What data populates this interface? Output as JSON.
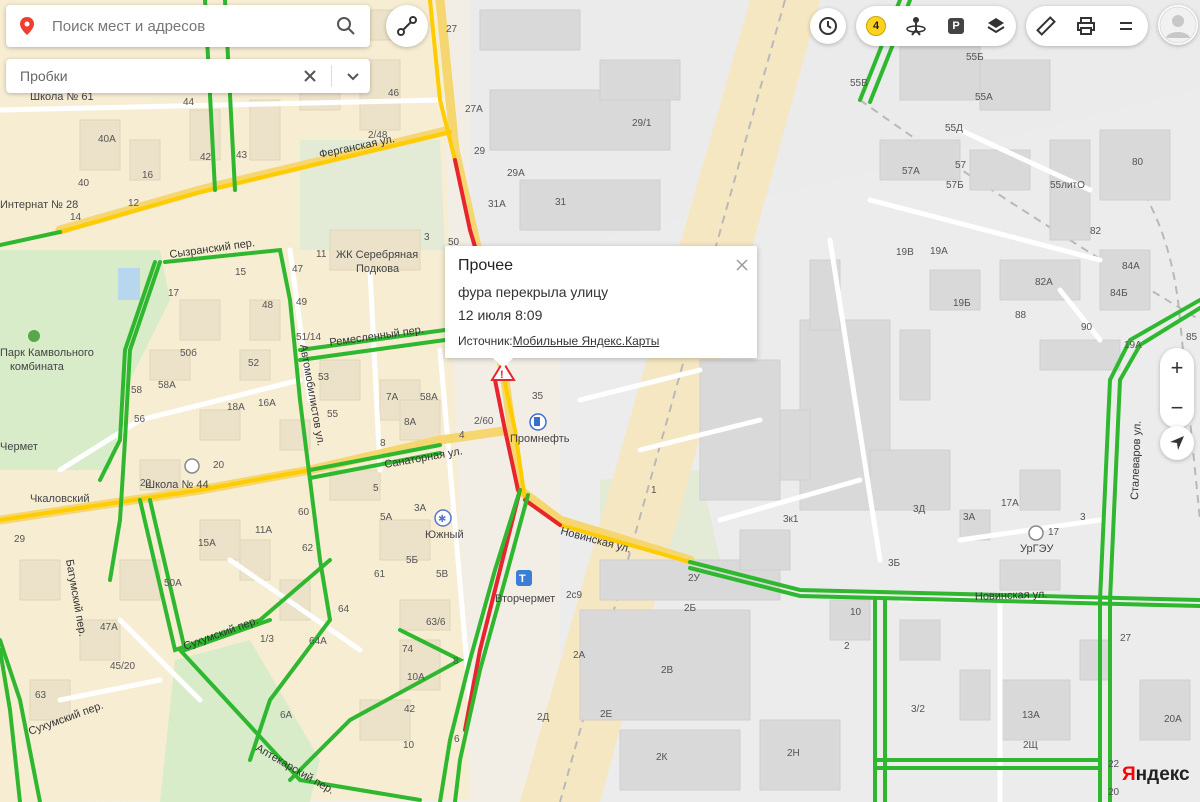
{
  "search": {
    "placeholder": "Поиск мест и адресов"
  },
  "traffic_layer": {
    "label": "Пробки"
  },
  "jams_level": "4",
  "parking_label": "P",
  "popup": {
    "title": "Прочее",
    "description": "фура перекрыла улицу",
    "date": "12 июля 8:09",
    "source_prefix": "Источник:",
    "source_link": "Мобильные Яндекс.Карты"
  },
  "zoom": {
    "in": "+",
    "out": "−"
  },
  "logo": {
    "first": "Я",
    "rest": "ндекс"
  },
  "streets": {
    "mostovaya": "Ремесленный пер.",
    "sanatornaya": "Санаторная ул.",
    "novinskaya1": "Новинская ул.",
    "novinskaya2": "Новинская ул.",
    "sukhumsky1": "Сухумский пер.",
    "sukhumsky2": "Сухумский пер.",
    "batumsky": "Батумский пер.",
    "syzransky": "Сызранский пер.",
    "ferganskaya": "Ферганская ул.",
    "avtomobilnaya": "Автомобилистов ул.",
    "aptekarsky": "Аптекарский пер.",
    "stalevarov": "Сталеваров ул."
  },
  "pois": {
    "school61": "Школа № 61",
    "internat28": "Интернат № 28",
    "park": "Парк Камвольного",
    "park2": "комбината",
    "chermet": "Чермет",
    "chkalovsky": "Чкаловский",
    "school44": "Школа № 44",
    "yuzhny": "Южный",
    "vtorchermet": "Вторчермет",
    "jk": "ЖК Серебряная",
    "jk2": "Подкова",
    "promneft": "Промнефть",
    "urgeu": "УрГЭУ"
  },
  "house_numbers": {
    "h27": "27",
    "h27a": "27А",
    "h29": "29",
    "h29a": "29А",
    "h29_1": "29/1",
    "h31": "31",
    "h31a": "31А",
    "h2_48": "2/48",
    "h46": "46",
    "h42": "42",
    "h43": "43",
    "h44": "44",
    "h40a": "40А",
    "h40": "40",
    "h16": "16",
    "h12": "12",
    "h14": "14",
    "h3": "3",
    "h50": "50",
    "h11": "11",
    "h15": "15",
    "h47": "47",
    "h48": "48",
    "h49": "49",
    "h17": "17",
    "h51_14": "51/14",
    "h506": "50б",
    "h52": "52",
    "h58": "58",
    "h58a": "58А",
    "h56": "56",
    "h18a": "18А",
    "h16a": "16А",
    "h53": "53",
    "h55": "55",
    "h7a": "7А",
    "h58a2": "58А",
    "h8a": "8А",
    "h4": "4",
    "h2_60": "2/60",
    "h35": "35",
    "h8": "8",
    "h20": "20",
    "h22": "22",
    "h5": "5",
    "h5a": "5А",
    "h3a": "3А",
    "h1": "1",
    "h60": "60",
    "h62": "62",
    "h61": "61",
    "h5b": "5Б",
    "h5v": "5В",
    "h64": "64",
    "h63_6": "63/6",
    "h74": "74",
    "h10a": "10А",
    "h42b": "42",
    "h10": "10",
    "h6a": "6А",
    "h1_3": "1/3",
    "h64a": "64А",
    "h29l": "29",
    "h50a": "50А",
    "h45_20": "45/20",
    "h63": "63",
    "h47a": "47А",
    "h11a": "11А",
    "h15a": "15А",
    "h55b": "55Б",
    "h55v": "55В",
    "h55a": "55А",
    "h55d": "55Д",
    "h57": "57",
    "h57a": "57А",
    "h57b": "57Б",
    "h55lito": "55литО",
    "h80": "80",
    "h82": "82",
    "h84a": "84А",
    "h84b": "84Б",
    "h82a": "82А",
    "h88": "88",
    "h90": "90",
    "h19v": "19В",
    "h19a": "19А",
    "h19b": "19Б",
    "h85": "85",
    "h19a2": "19А",
    "h3d": "3Д",
    "h3a2": "3А",
    "h3k1": "3к1",
    "h3b": "3Б",
    "h17a": "17А",
    "h3r": "3",
    "h2u": "2У",
    "h2b": "2Б",
    "h2a": "2А",
    "h2v": "2В",
    "h2d": "2Д",
    "h2e": "2Е",
    "h2k": "2К",
    "h2n": "2Н",
    "h2c9": "2с9",
    "h13a": "13А",
    "h3_2": "3/2",
    "h2sh": "2Щ",
    "h20a": "20А",
    "h10r": "10",
    "h2r": "2",
    "h22r": "22",
    "h20r": "20",
    "h27r": "27",
    "h8r": "8",
    "h6r": "6"
  }
}
